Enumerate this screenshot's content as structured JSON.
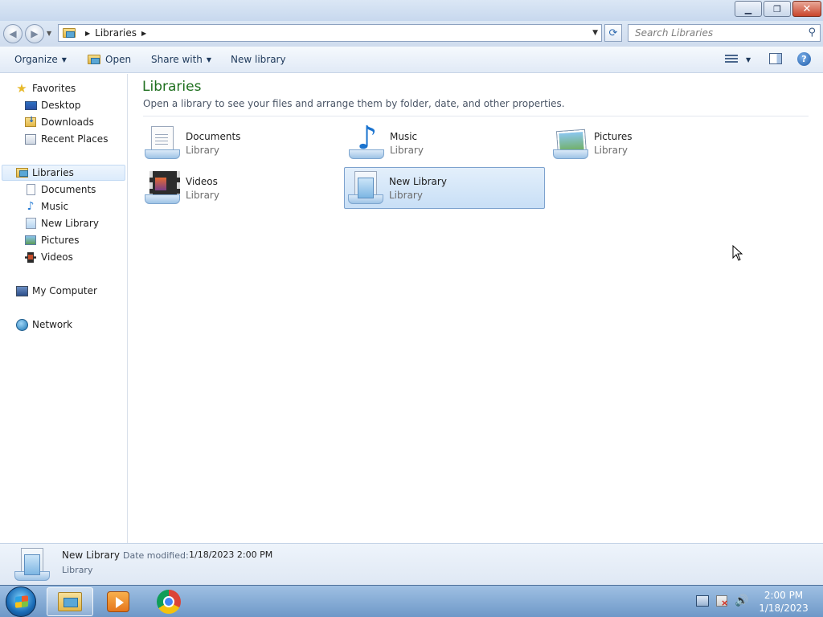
{
  "window": {
    "controls": {
      "minimize": "▁",
      "maximize": "❐",
      "close": "✕"
    }
  },
  "address": {
    "back_icon": "arrow-left-icon",
    "forward_icon": "arrow-right-icon",
    "crumb": "Libraries",
    "search_placeholder": "Search Libraries"
  },
  "toolbar": {
    "organize": "Organize",
    "open": "Open",
    "share_with": "Share with",
    "new_library": "New library"
  },
  "nav": {
    "favorites": "Favorites",
    "desktop": "Desktop",
    "downloads": "Downloads",
    "recent_places": "Recent Places",
    "libraries": "Libraries",
    "documents": "Documents",
    "music": "Music",
    "new_library": "New Library",
    "pictures": "Pictures",
    "videos": "Videos",
    "my_computer": "My Computer",
    "network": "Network"
  },
  "content": {
    "title": "Libraries",
    "description": "Open a library to see your files and arrange them by folder, date, and other properties.",
    "items": [
      {
        "name": "Documents",
        "type": "Library"
      },
      {
        "name": "Music",
        "type": "Library"
      },
      {
        "name": "Pictures",
        "type": "Library"
      },
      {
        "name": "Videos",
        "type": "Library"
      },
      {
        "name": "New Library",
        "type": "Library",
        "selected": true
      }
    ]
  },
  "details": {
    "name": "New Library",
    "modified_label": "Date modified:",
    "modified_value": "1/18/2023 2:00 PM",
    "type": "Library"
  },
  "taskbar": {
    "time": "2:00 PM",
    "date": "1/18/2023"
  },
  "colors": {
    "title_green": "#1e6f1e",
    "selection_blue": "#c8dff6",
    "taskbar": "#6e98c8"
  }
}
